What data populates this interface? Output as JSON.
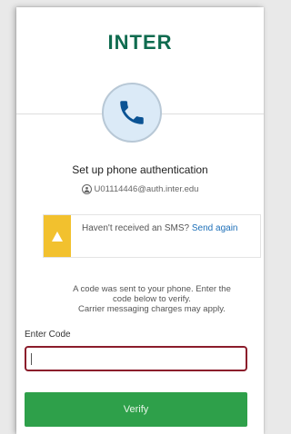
{
  "brand": {
    "logo_text": "INTER",
    "accent": "#0f6b4f",
    "dot_color": "#f2c230"
  },
  "header": {
    "title": "Set up phone authentication",
    "email": "U01114446@auth.inter.edu"
  },
  "alert": {
    "message": "Haven't received an SMS?",
    "link_text": "Send again",
    "color": "#f2c12e"
  },
  "info": {
    "line1": "A code was sent to your phone. Enter the",
    "line2": "code below to verify.",
    "line3": "Carrier messaging charges may apply."
  },
  "form": {
    "code_label": "Enter Code",
    "code_value": "",
    "verify_label": "Verify",
    "verify_color": "#2ea04a"
  },
  "icons": {
    "phone": "phone-icon",
    "user": "user-icon",
    "warning": "warning-icon"
  }
}
